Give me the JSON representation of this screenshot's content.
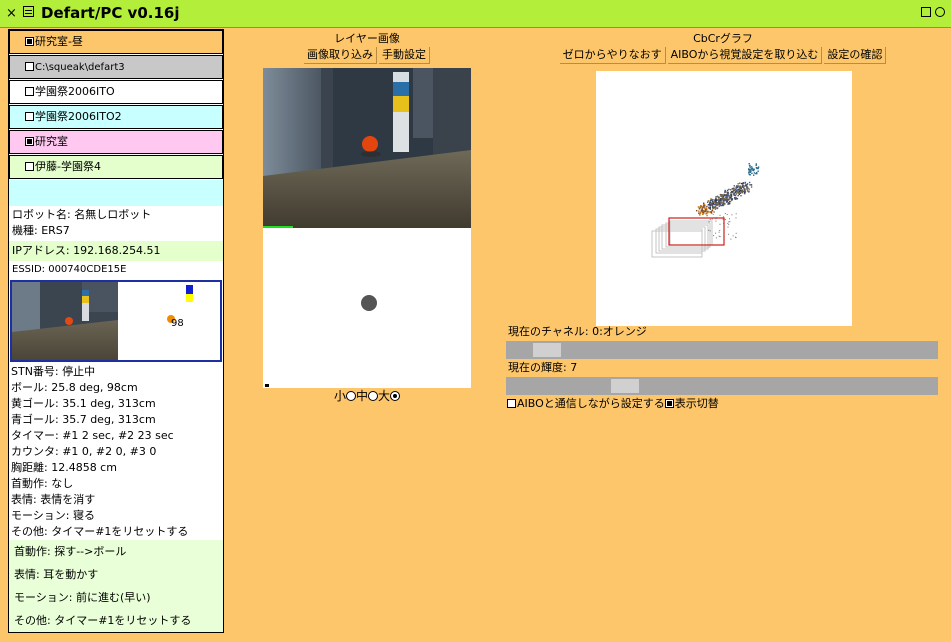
{
  "window": {
    "title": "Defart/PC v0.16j"
  },
  "profiles": [
    {
      "label": "研究室-昼",
      "checked": true,
      "bg": "#fdc66a"
    },
    {
      "label": "C:\\squeak\\defart3",
      "checked": false,
      "bg": "#c8c8c8"
    },
    {
      "label": "学園祭2006ITO",
      "checked": false,
      "bg": "#ffffff"
    },
    {
      "label": "学園祭2006ITO2",
      "checked": false,
      "bg": "#c8ffff"
    },
    {
      "label": "研究室",
      "checked": true,
      "bg": "#ffc8f0"
    },
    {
      "label": "伊藤-学園祭4",
      "checked": false,
      "bg": "#e4ffcc"
    }
  ],
  "robot": {
    "name_line": "ロボット名: 名無しロボット",
    "model_line": "機種: ERS7",
    "ip_line": "IPアドレス: 192.168.254.51",
    "essid_line": "ESSID: 000740CDE15E"
  },
  "thumb": {
    "distance_label": "98"
  },
  "status_lines": [
    "STN番号: 停止中",
    "ボール: 25.8 deg, 98cm",
    "黄ゴール: 35.1 deg, 313cm",
    "青ゴール: 35.7 deg, 313cm",
    "タイマー: #1 2 sec, #2 23 sec",
    "カウンタ: #1 0, #2 0, #3 0",
    "胸距離: 12.4858 cm",
    "首動作: なし",
    "表情: 表情を消す",
    "モーション: 寝る",
    "その他: タイマー#1をリセットする"
  ],
  "actions": [
    "首動作: 探す-->ボール",
    "表情: 耳を動かす",
    "モーション: 前に進む(早い)",
    "その他: タイマー#1をリセットする"
  ],
  "layer": {
    "title": "レイヤー画像",
    "import_label": "画像取り込み",
    "manual_label": "手動設定",
    "size_small": "小",
    "size_medium": "中",
    "size_large": "大",
    "selected_size": "large"
  },
  "graph": {
    "title": "CbCrグラフ",
    "reset_label": "ゼロからやりなおす",
    "load_label": "AIBOから視覚設定を取り込む",
    "check_label": "設定の確認",
    "channel_label": "現在のチャネル: 0:オレンジ",
    "channel_value": 0.06,
    "lum_label": "現在の輝度: 7",
    "lum_value": 0.26,
    "comm_label": "AIBOと通信しながら設定する",
    "comm_checked": false,
    "toggle_label": "表示切替",
    "toggle_checked": true
  },
  "colors": {
    "background": "#fdc66a",
    "titlebar": "#b2ee3a",
    "accent_selection": "#1c2fa3"
  }
}
